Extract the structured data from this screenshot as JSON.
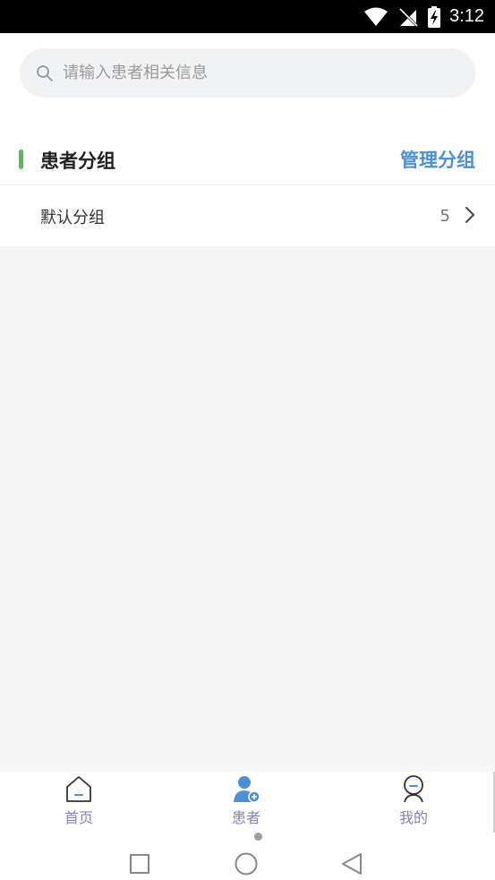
{
  "status_bar": {
    "time": "3:12"
  },
  "search": {
    "placeholder": "请输入患者相关信息"
  },
  "section": {
    "title": "患者分组",
    "manage_label": "管理分组"
  },
  "groups": [
    {
      "name": "默认分组",
      "count": "5"
    }
  ],
  "bottom_nav": {
    "items": [
      {
        "label": "首页",
        "icon": "home-icon"
      },
      {
        "label": "患者",
        "icon": "patient-icon",
        "active": true
      },
      {
        "label": "我的",
        "icon": "profile-icon"
      }
    ]
  },
  "colors": {
    "accent_green": "#5cb85c",
    "link_blue": "#4a90d9",
    "nav_label": "#8a7fb3",
    "active_icon": "#4a90d9"
  }
}
